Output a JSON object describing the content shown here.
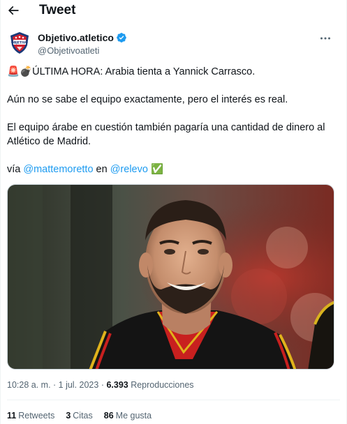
{
  "header": {
    "title": "Tweet",
    "back_icon": "arrow-left-icon"
  },
  "author": {
    "display_name": "Objetivo.atletico",
    "handle": "@Objetivoatleti",
    "verified": true,
    "avatar_icon": "shield-logo"
  },
  "tweet": {
    "line1_emoji": "🚨💣",
    "line1_text": "ÚLTIMA HORA: Arabia tienta a Yannick Carrasco.",
    "line2": "Aún no se sabe el equipo exactamente, pero el interés es real.",
    "line3": "El equipo árabe en cuestión también pagaría una cantidad de dinero al",
    "line4": "Atlético de Madrid.",
    "via_prefix": "vía ",
    "mention1": "@mattemoretto",
    "via_mid": " en ",
    "mention2": "@relevo",
    "check_emoji": "✅"
  },
  "meta": {
    "time": "10:28 a. m.",
    "sep1": " · ",
    "date": "1 jul. 2023",
    "sep2": " · ",
    "views_count": "6.393",
    "views_label": " Reproducciones"
  },
  "stats": {
    "retweets_count": "11",
    "retweets_label": "Retweets",
    "quotes_count": "3",
    "quotes_label": "Citas",
    "likes_count": "86",
    "likes_label": "Me gusta"
  },
  "colors": {
    "accent": "#1d9bf0",
    "text": "#0f1419",
    "secondary": "#536471"
  }
}
